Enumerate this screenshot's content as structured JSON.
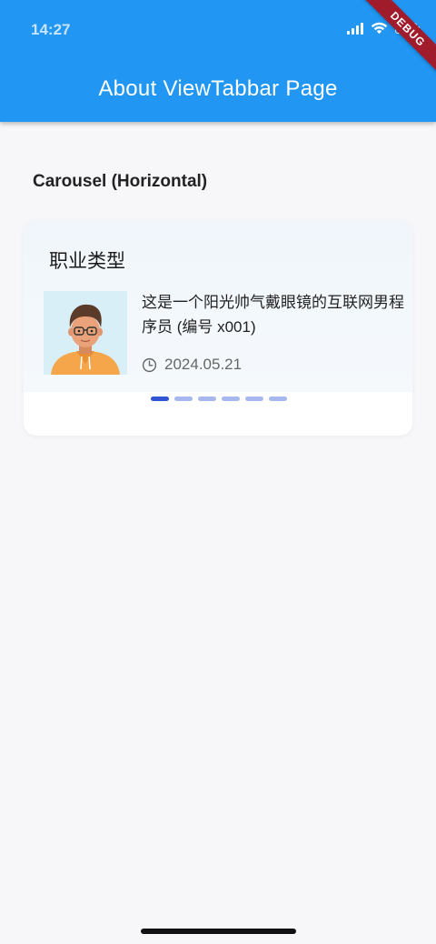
{
  "status_bar": {
    "time": "14:27",
    "icons": [
      "signal-icon",
      "wifi-icon",
      "battery-icon"
    ]
  },
  "debug_banner": "DEBUG",
  "app_bar": {
    "title": "About ViewTabbar Page",
    "color": "#2196f3"
  },
  "section": {
    "title": "Carousel (Horizontal)"
  },
  "carousel": {
    "card_title": "职业类型",
    "item": {
      "avatar": "developer-avatar",
      "description": "这是一个阳光帅气戴眼镜的互联网男程序员 (编号 x001)",
      "date_icon": "clock-icon",
      "date": "2024.05.21"
    },
    "page_count": 6,
    "active_page": 1,
    "indicator_active_color": "#2f54d6",
    "indicator_inactive_color": "#a8b8ee"
  }
}
